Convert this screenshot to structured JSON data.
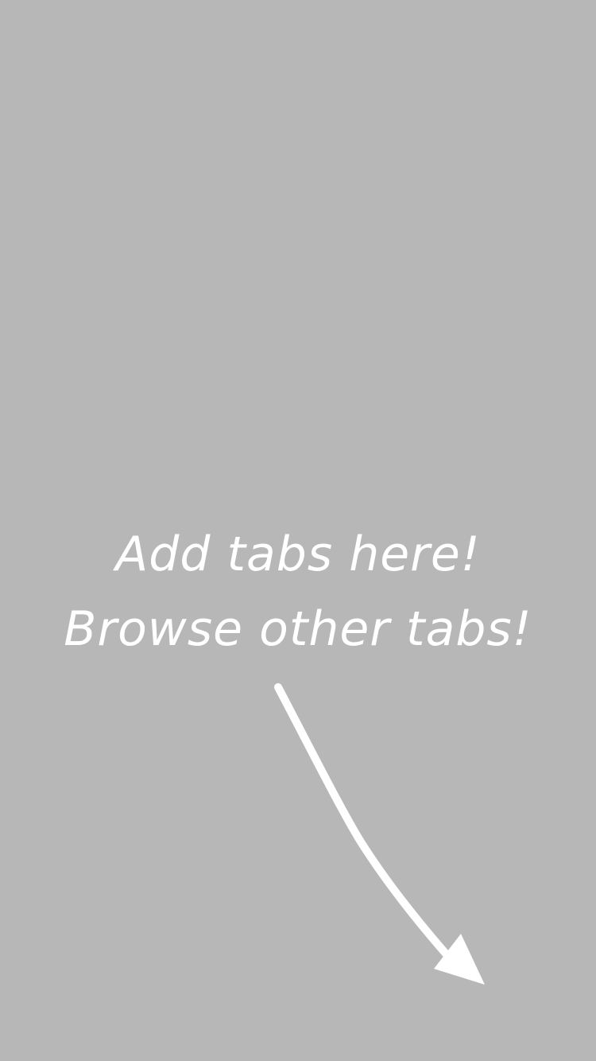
{
  "overlay": {
    "background_color": "#b7b7b7",
    "text_color": "#ffffff",
    "lines": [
      "Add tabs here!",
      "Browse other tabs!"
    ],
    "arrow_icon": "curved-arrow-down-right"
  }
}
